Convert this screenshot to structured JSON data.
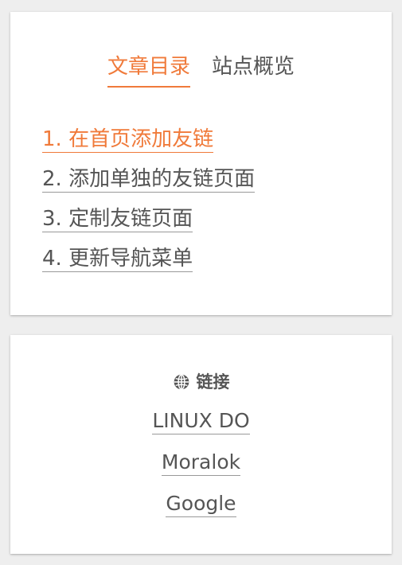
{
  "toc_widget": {
    "tabs": [
      {
        "label": "文章目录",
        "active": true
      },
      {
        "label": "站点概览",
        "active": false
      }
    ],
    "items": [
      {
        "label": "1. 在首页添加友链",
        "active": true
      },
      {
        "label": "2. 添加单独的友链页面",
        "active": false
      },
      {
        "label": "3. 定制友链页面",
        "active": false
      },
      {
        "label": "4. 更新导航菜单",
        "active": false
      }
    ]
  },
  "links_widget": {
    "icon": "globe-icon",
    "title": "链接",
    "links": [
      {
        "label": "LINUX DO"
      },
      {
        "label": "Moralok"
      },
      {
        "label": "Google"
      }
    ]
  },
  "colors": {
    "accent": "#f07a3a",
    "text": "#555555",
    "background": "#eeeeee",
    "panel": "#ffffff"
  }
}
